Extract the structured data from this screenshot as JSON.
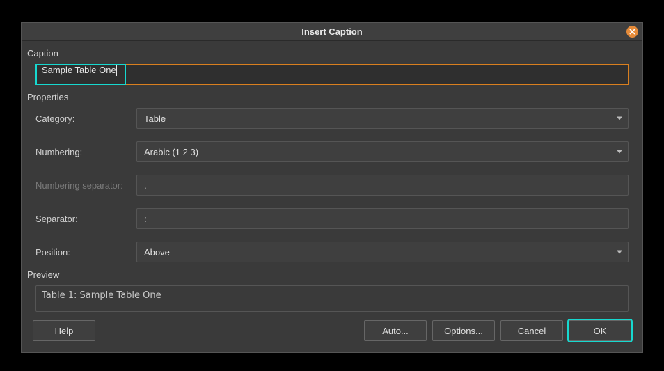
{
  "title": "Insert Caption",
  "sections": {
    "caption_label": "Caption",
    "properties_label": "Properties",
    "preview_label": "Preview"
  },
  "caption_value": "Sample Table One",
  "properties": {
    "category_label": "Category:",
    "category_value": "Table",
    "numbering_label": "Numbering:",
    "numbering_value": "Arabic (1 2 3)",
    "numbering_sep_label": "Numbering separator:",
    "numbering_sep_value": ".",
    "separator_label": "Separator:",
    "separator_value": ": ",
    "position_label": "Position:",
    "position_value": "Above"
  },
  "preview_value": "Table 1: Sample Table One",
  "buttons": {
    "help": "Help",
    "auto": "Auto...",
    "options": "Options...",
    "cancel": "Cancel",
    "ok": "OK"
  }
}
